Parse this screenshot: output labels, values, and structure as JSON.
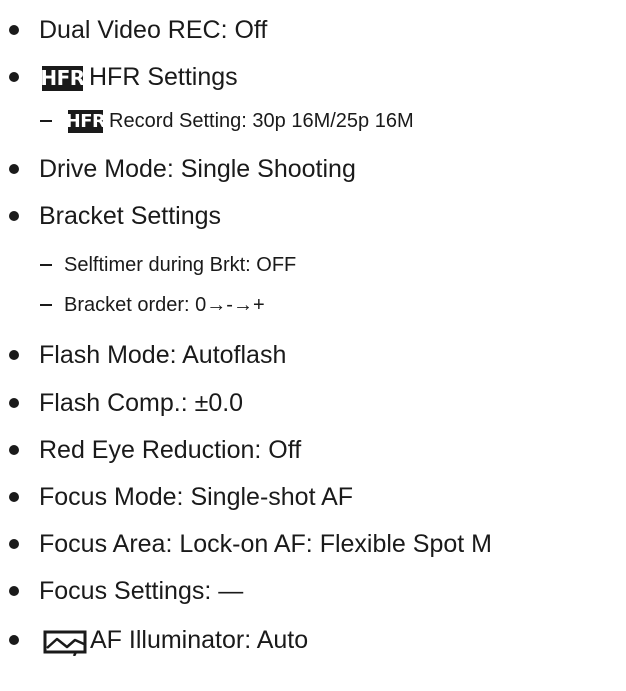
{
  "icons": {
    "hfr_badge_text": "HFR",
    "af_illuminator_icon": "af-illuminator-icon"
  },
  "items": [
    {
      "level": 1,
      "text": "Dual Video REC: Off"
    },
    {
      "level": 1,
      "icon": "hfr",
      "text": "HFR Settings"
    },
    {
      "level": 2,
      "icon": "hfr",
      "text": "Record Setting: 30p 16M/25p 16M"
    },
    {
      "level": 1,
      "text": "Drive Mode: Single Shooting"
    },
    {
      "level": 1,
      "text": "Bracket Settings"
    },
    {
      "level": 2,
      "text": "Selftimer during Brkt: OFF"
    },
    {
      "level": 2,
      "text": "Bracket order: 0→-→+"
    },
    {
      "level": 1,
      "text": "Flash Mode: Autoflash"
    },
    {
      "level": 1,
      "text": "Flash Comp.: ±0.0"
    },
    {
      "level": 1,
      "text": "Red Eye Reduction: Off"
    },
    {
      "level": 1,
      "text": "Focus Mode: Single-shot AF"
    },
    {
      "level": 1,
      "text": "Focus Area: Lock-on AF: Flexible Spot M"
    },
    {
      "level": 1,
      "text": "Focus Settings: —"
    },
    {
      "level": 1,
      "icon": "af-illuminator",
      "text": "AF Illuminator: Auto"
    }
  ]
}
